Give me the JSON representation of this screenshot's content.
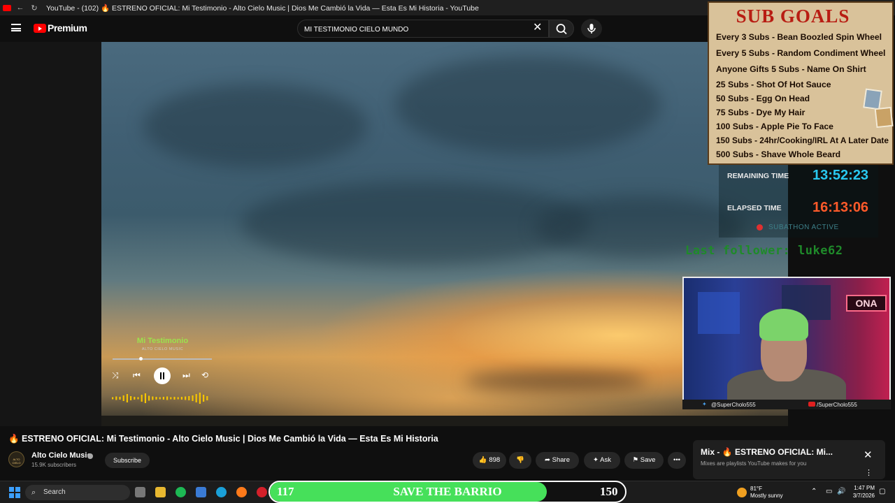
{
  "browser": {
    "tab_title": "YouTube - (102) 🔥 ESTRENO OFICIAL: Mi Testimonio - Alto Cielo Music | Dios Me Cambió la Vida — Esta Es Mi Historia - YouTube"
  },
  "youtube": {
    "logo_text": "Premium",
    "search_value": "MI TESTIMONIO CIELO MUNDO"
  },
  "player_overlay": {
    "song_title": "Mi Testimonio",
    "artist": "ALTO CIELO MUSIC",
    "progress_fraction": 0.28
  },
  "video": {
    "title": "🔥 ESTRENO OFICIAL: Mi Testimonio - Alto Cielo Music | Dios Me Cambió la Vida — Esta Es Mi Historia",
    "channel_name": "Alto Cielo Music",
    "channel_avatar_text": "ALTO CIELO",
    "subscribers": "15.9K subscribers",
    "subscribe_label": "Subscribe",
    "likes": "898",
    "share_label": "Share",
    "ask_label": "Ask",
    "save_label": "Save"
  },
  "mix_panel": {
    "title": "Mix - 🔥 ESTRENO OFICIAL: Mi...",
    "subtitle": "Mixes are playlists YouTube makes for you"
  },
  "sub_goals": {
    "title": "SUB GOALS",
    "items": [
      "Every 3 Subs - Bean Boozled Spin Wheel",
      "Every 5 Subs - Random Condiment Wheel",
      "Anyone Gifts 5 Subs - Name On Shirt",
      "25 Subs - Shot Of Hot Sauce",
      "50 Subs - Egg On Head",
      "75 Subs - Dye My Hair",
      "100 Subs - Apple Pie To Face",
      "150 Subs - 24hr/Cooking/IRL At A Later Date",
      "500 Subs - Shave Whole Beard"
    ]
  },
  "subathon": {
    "remaining_label": "REMAINING TIME",
    "remaining_value": "13:52:23",
    "elapsed_label": "ELAPSED TIME",
    "elapsed_value": "16:13:06",
    "status": "SUBATHON ACTIVE",
    "remaining_color": "#29c8f0",
    "elapsed_color": "#ff5a2a"
  },
  "last_follower": "Last follower: luke62",
  "webcam": {
    "sign_text": "ONA",
    "twitter": "@SuperCholo555",
    "youtube": "/SuperCholo555"
  },
  "goal_bar": {
    "current": "117",
    "label": "SAVE THE BARRIO",
    "target": "150",
    "fill_fraction": 0.78
  },
  "taskbar": {
    "search_label": "Search",
    "weather_temp": "81°F",
    "weather_desc": "Mostly sunny",
    "time": "1:47 PM",
    "date": "3/7/2026"
  }
}
